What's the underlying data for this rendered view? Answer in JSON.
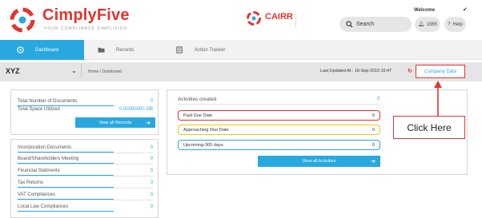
{
  "brand": {
    "name": "CimplyFive",
    "tagline": "YOUR COMPLIANCE SIMPLIFIED",
    "product": "CAIRR"
  },
  "header": {
    "welcome": "Welcome",
    "search_label": "Search",
    "notification_count": "1565",
    "help_label": "Help"
  },
  "nav": {
    "items": [
      {
        "label": "Dashboard",
        "active": true
      },
      {
        "label": "Records",
        "active": false
      },
      {
        "label": "Action Tracker",
        "active": false
      }
    ]
  },
  "subheader": {
    "company": "XYZ",
    "breadcrumb": "Home  /  Dashboard",
    "last_updated": "Last Updated At : 16-Sep-2019 15:47",
    "company_data_button": "Company Data"
  },
  "documents": {
    "total_docs_label": "Total Number of Documents",
    "total_docs_value": "0",
    "total_space_label": "Total Space Utilized",
    "total_space_value": "0.00000000 GB",
    "view_button": "View all Records"
  },
  "categories": [
    {
      "label": "Incorporation Documents",
      "value": "0"
    },
    {
      "label": "Board/Shareholders Meeting",
      "value": "0"
    },
    {
      "label": "Financial Statments",
      "value": "0"
    },
    {
      "label": "Tax Returns",
      "value": "0"
    },
    {
      "label": "VAT Compliances",
      "value": "0"
    },
    {
      "label": "Local Law Compliances",
      "value": "0"
    }
  ],
  "activities": {
    "title": "Activities created",
    "count": "0",
    "rows": [
      {
        "label": "Past Due Date",
        "value": "0"
      },
      {
        "label": "Approaching Due Date",
        "value": "0"
      },
      {
        "label": "Upcoming-365 days",
        "value": "0"
      }
    ],
    "view_button": "View all Activities"
  },
  "annotation": {
    "text": "Click Here"
  },
  "colors": {
    "accent": "#29a8e0",
    "brand_red": "#e3342f",
    "warning": "#f0c419"
  }
}
